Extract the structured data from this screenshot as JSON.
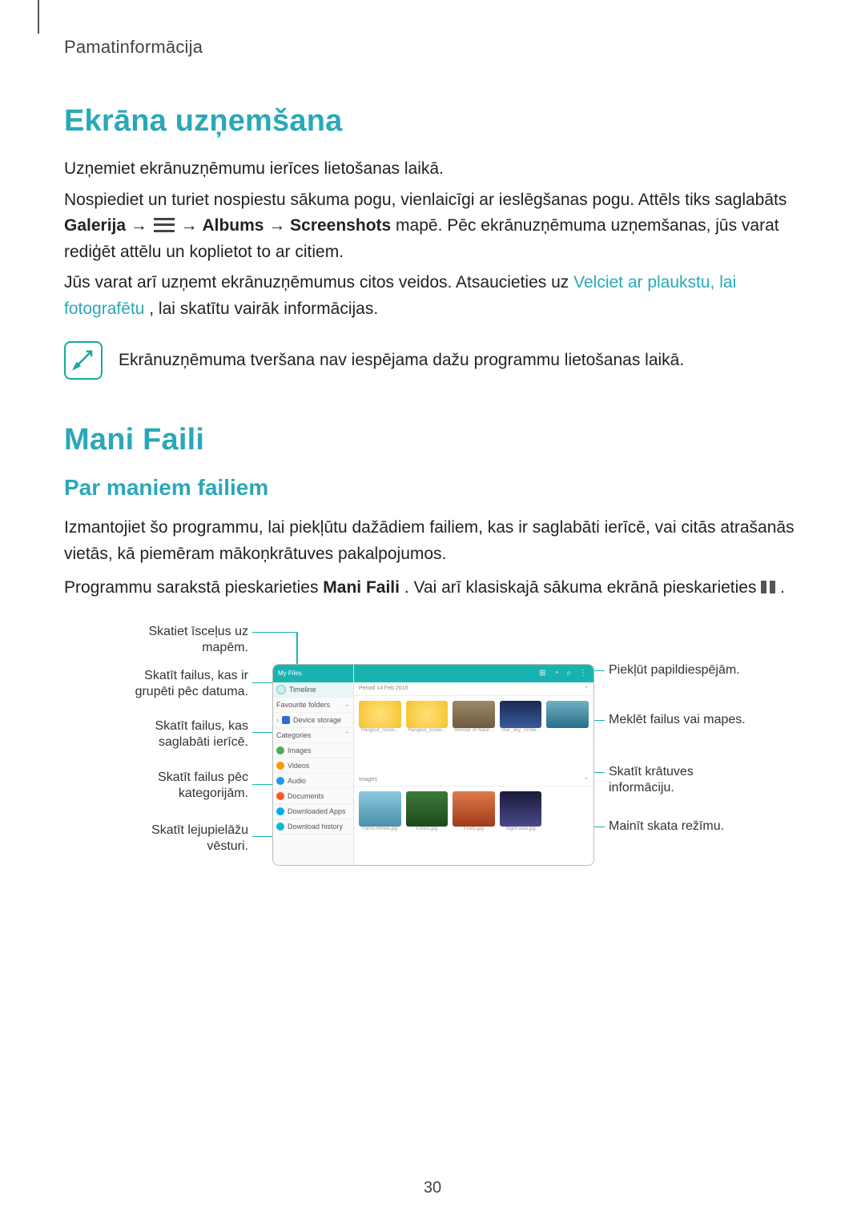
{
  "header": {
    "title": "Pamatinformācija"
  },
  "section1": {
    "title": "Ekrāna uzņemšana",
    "p1": "Uzņemiet ekrānuzņēmumu ierīces lietošanas laikā.",
    "p2a": "Nospiediet un turiet nospiestu sākuma pogu, vienlaicīgi ar ieslēgšanas pogu. Attēls tiks saglabāts ",
    "p2_gallery": "Galerija",
    "p2_arrow": " → ",
    "p2_albums": "Albums",
    "p2_screens": "Screenshots",
    "p2b": " mapē. Pēc ekrānuzņēmuma uzņemšanas, jūs varat rediģēt attēlu un koplietot to ar citiem.",
    "p3a": "Jūs varat arī uzņemt ekrānuzņēmumus citos veidos. Atsaucieties uz ",
    "p3_link": "Velciet ar plaukstu, lai fotografētu",
    "p3b": ", lai skatītu vairāk informācijas.",
    "note": "Ekrānuzņēmuma tveršana nav iespējama dažu programmu lietošanas laikā."
  },
  "section2": {
    "title": "Mani Faili",
    "subtitle": "Par maniem failiem",
    "p1": "Izmantojiet šo programmu, lai piekļūtu dažādiem failiem, kas ir saglabāti ierīcē, vai citās atrašanās vietās, kā piemēram mākoņkrātuves pakalpojumos.",
    "p2a": "Programmu sarakstā pieskarieties ",
    "p2_bold": "Mani Faili",
    "p2b": ". Vai arī klasiskajā sākuma ekrānā pieskarieties ",
    "p2c": "."
  },
  "callouts": {
    "left": [
      "Skatiet īsceļus uz mapēm.",
      "Skatīt failus, kas ir grupēti pēc datuma.",
      "Skatīt failus, kas saglabāti ierīcē.",
      "Skatīt failus pēc kategorijām.",
      "Skatīt lejupielāžu vēsturi."
    ],
    "right": [
      "Piekļūt papildiespējām.",
      "Meklēt failus vai mapes.",
      "Skatīt krātuves informāciju.",
      "Mainīt skata režīmu."
    ]
  },
  "device": {
    "sidebar_title": "My Files",
    "timeline": "Timeline",
    "favorite": "Favourite folders",
    "device_storage": "Device storage",
    "categories": "Categories",
    "images": "Images",
    "videos": "Videos",
    "audio": "Audio",
    "documents": "Documents",
    "downloaded": "Downloaded Apps",
    "history": "Download history",
    "sub_date": "Period   14 Feb 2015",
    "caps": [
      "Hangout_Scree...",
      "Hangout_Scree...",
      "Wonder of Natur...",
      "Star_Sky_Scree...",
      ""
    ],
    "caps2": [
      "Ferris-Wheel.jpg",
      "Forest.jpg",
      "Fruits.jpg",
      "Night-view.jpg"
    ]
  },
  "page_number": "30"
}
